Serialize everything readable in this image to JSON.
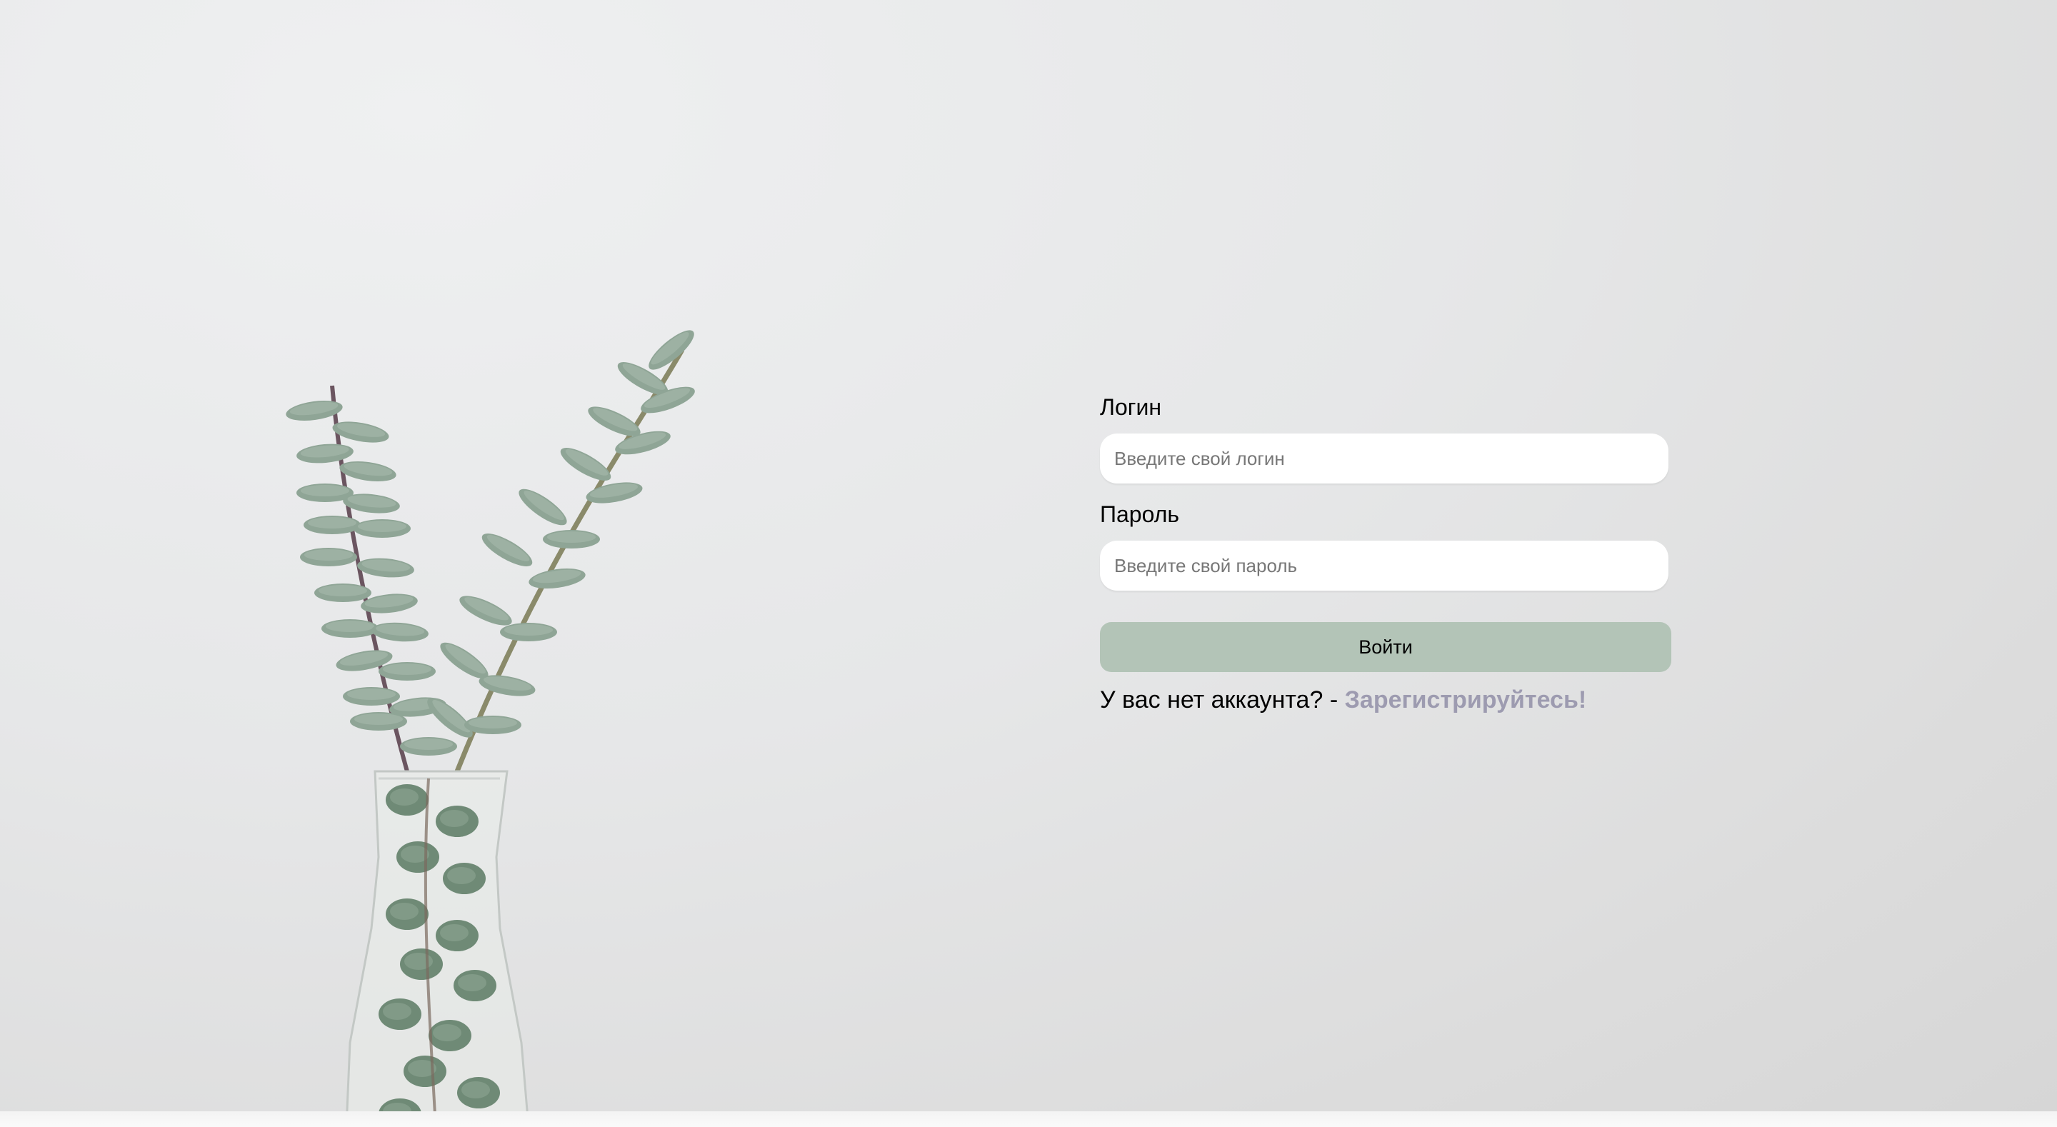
{
  "login_form": {
    "login_label": "Логин",
    "login_placeholder": "Введите свой логин",
    "login_value": "",
    "password_label": "Пароль",
    "password_placeholder": "Введите свой пароль",
    "password_value": "",
    "submit_label": "Войти",
    "register_prompt": "У вас нет аккаунта? -",
    "register_link": "Зарегистрируйтесь!"
  },
  "colors": {
    "background": "#e4e5e6",
    "button": "#b3c4b7",
    "link": "#9d9bb0",
    "leaf": "#7f9a86"
  }
}
